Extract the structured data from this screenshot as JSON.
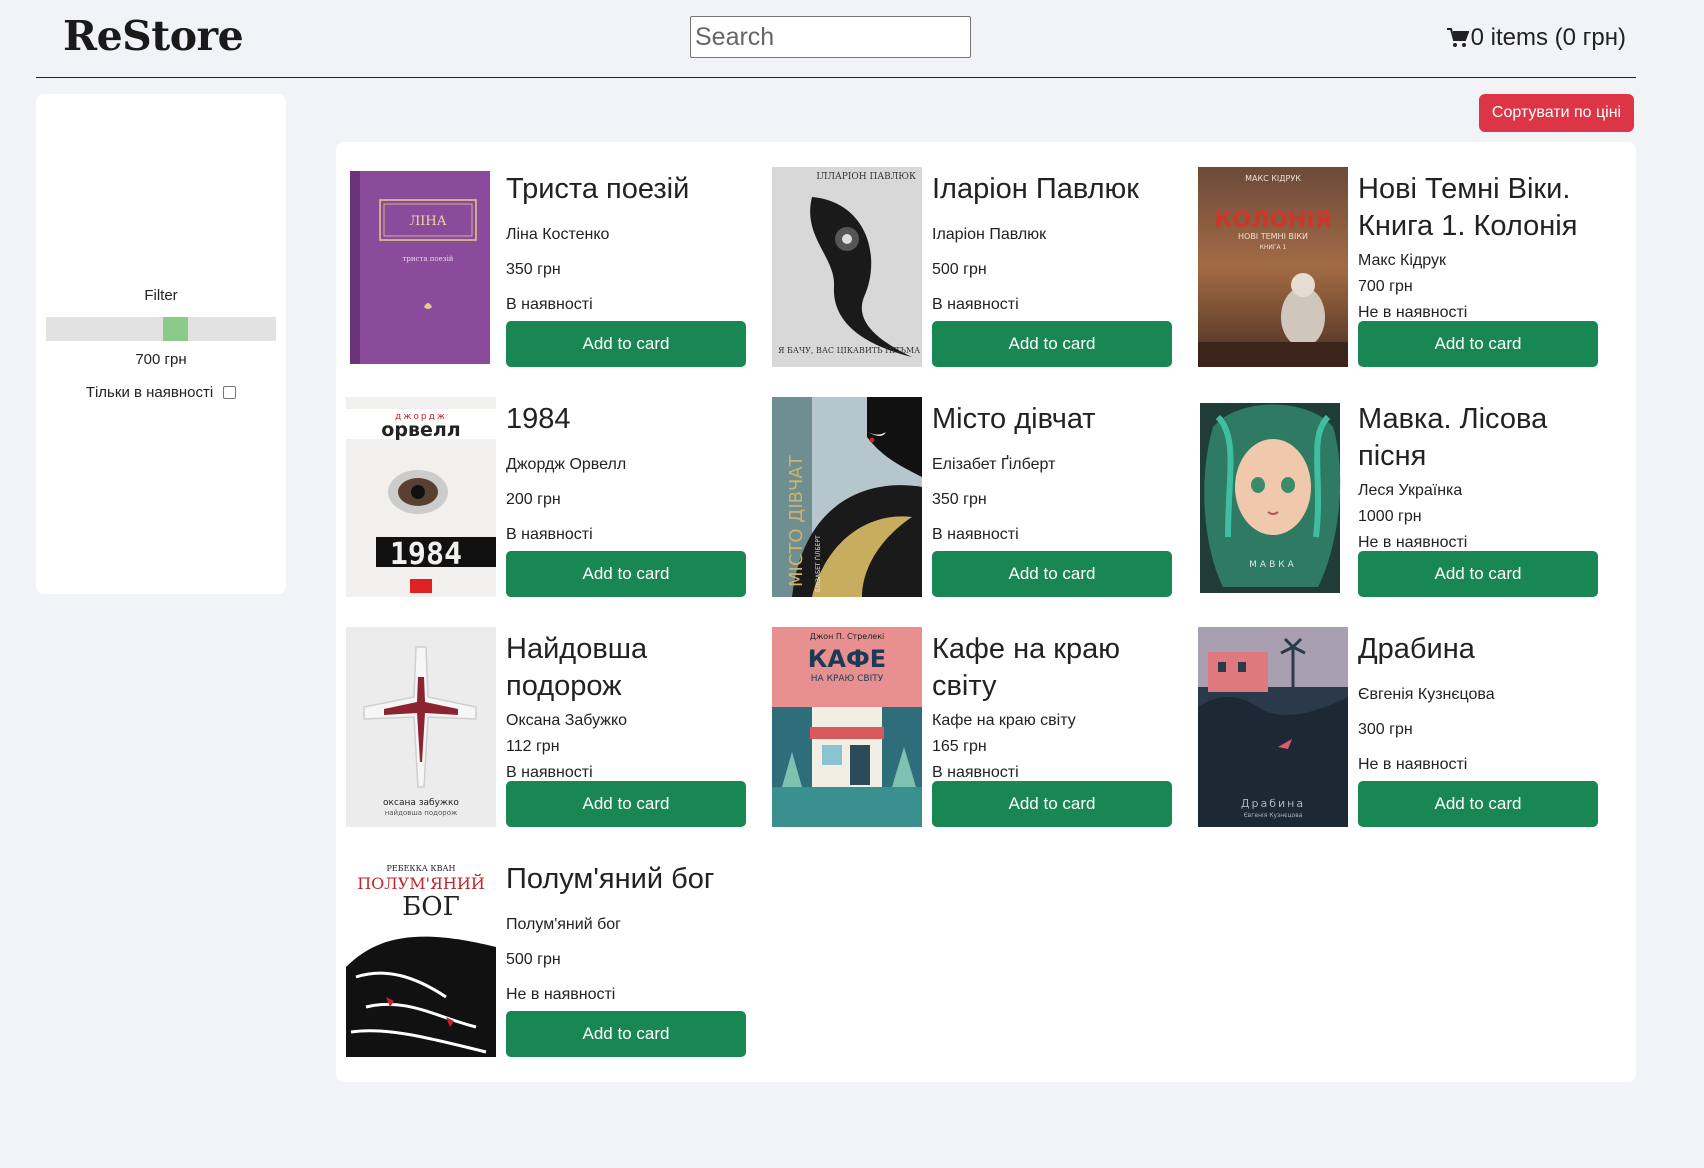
{
  "header": {
    "logo": "ReStore",
    "search_placeholder": "Search",
    "cart_text": "0 items (0 грн)"
  },
  "sidebar": {
    "filter_label": "Filter",
    "price_label": "700 грн",
    "price_slider_fraction": 0.57,
    "in_stock_label": "Тільки в наявності",
    "in_stock_checked": false
  },
  "toolbar": {
    "sort_label": "Сортувати по ціні"
  },
  "colors": {
    "accent_green": "#198754",
    "sort_red": "#dc3545",
    "slider_thumb": "#8acb8a"
  },
  "products": [
    {
      "title": "Триста поезій",
      "author": "Ліна Костенко",
      "price": "350 грн",
      "stock": "В наявності",
      "button": "Add to card"
    },
    {
      "title": "Іларіон Павлюк",
      "author": "Іларіон Павлюк",
      "price": "500 грн",
      "stock": "В наявності",
      "button": "Add to card"
    },
    {
      "title": "Нові Темні Віки. Книга 1. Колонія",
      "author": "Макс Кідрук",
      "price": "700 грн",
      "stock": "Не в наявності",
      "button": "Add to card"
    },
    {
      "title": "1984",
      "author": "Джордж Орвелл",
      "price": "200 грн",
      "stock": "В наявності",
      "button": "Add to card"
    },
    {
      "title": "Місто дівчат",
      "author": "Елізабет Ґілберт",
      "price": "350 грн",
      "stock": "В наявності",
      "button": "Add to card"
    },
    {
      "title": "Мавка. Лісова пісня",
      "author": "Леся Українка",
      "price": "1000 грн",
      "stock": "Не в наявності",
      "button": "Add to card"
    },
    {
      "title": "Найдовша подорож",
      "author": "Оксана Забужко",
      "price": "112 грн",
      "stock": "В наявності",
      "button": "Add to card"
    },
    {
      "title": "Кафе на краю світу",
      "author": "Кафе на краю світу",
      "price": "165 грн",
      "stock": "В наявності",
      "button": "Add to card"
    },
    {
      "title": "Драбина",
      "author": "Євгенія Кузнєцова",
      "price": "300 грн",
      "stock": "Не в наявності",
      "button": "Add to card"
    },
    {
      "title": "Полум'яний бог",
      "author": "Полум'яний бог",
      "price": "500 грн",
      "stock": "Не в наявності",
      "button": "Add to card"
    }
  ],
  "covers": {
    "c0": {
      "top": "ЛІНА",
      "sub": "триста поезій"
    },
    "c1": {
      "top": "ІЛЛАРІОН ПАВЛЮК",
      "bottom": "Я БАЧУ, ВАС ЦІКАВИТЬ ПІТЬМА"
    },
    "c2": {
      "top": "МАКС КІДРУК",
      "title": "КОЛОНІЯ",
      "sub": "НОВІ ТЕМНІ ВІКИ",
      "book": "КНИГА 1"
    },
    "c3": {
      "top": "джордж",
      "author": "орвелл",
      "title": "1984"
    },
    "c4": {
      "title": "МІСТО ДІВЧАТ",
      "author": "ЕЛІЗАБЕТ ҐІЛБЕРТ"
    },
    "c5": {
      "title": "МАВКА"
    },
    "c6": {
      "author": "оксана забужко",
      "title": "найдовша подорож"
    },
    "c7": {
      "author": "Джон П. Стрелекі",
      "title": "КАФЕ",
      "sub": "НА КРАЮ СВІТУ"
    },
    "c8": {
      "title": "Драбина",
      "author": "Євгенія Кузнєцова"
    },
    "c9": {
      "author": "РЕБЕККА КВАН",
      "title1": "ПОЛУМ'ЯНИЙ",
      "title2": "БОГ"
    }
  }
}
